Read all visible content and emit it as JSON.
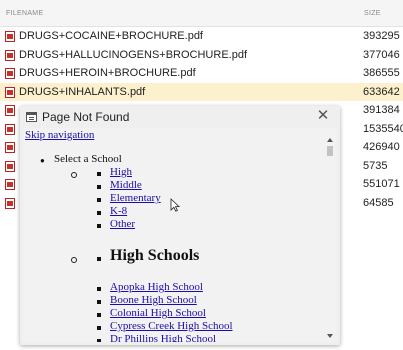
{
  "file_list": {
    "header_name": "FILENAME",
    "header_size": "SIZE",
    "rows": [
      {
        "name": "DRUGS+COCAINE+BROCHURE.pdf",
        "size": "393295"
      },
      {
        "name": "DRUGS+HALLUCINOGENS+BROCHURE.pdf",
        "size": "377046"
      },
      {
        "name": "DRUGS+HEROIN+BROCHURE.pdf",
        "size": "386555"
      },
      {
        "name": "DRUGS+INHALANTS.pdf",
        "size": "633642",
        "selected": true
      },
      {
        "name": "",
        "size": "391384"
      },
      {
        "name": "",
        "size": "1535540"
      },
      {
        "name": "",
        "size": "426940"
      },
      {
        "name": "",
        "size": "5735"
      },
      {
        "name": "",
        "size": "551071"
      },
      {
        "name": "",
        "size": "64585"
      }
    ]
  },
  "popup": {
    "title": "Page Not Found",
    "close_glyph": "✕",
    "skip_nav": "Skip navigation",
    "select_school": "Select a School",
    "school_levels": [
      "High",
      "Middle",
      "Elementary",
      "K-8",
      "Other"
    ],
    "high_schools_heading": "High Schools",
    "high_schools": [
      "Apopka High School",
      "Boone High School",
      "Colonial High School",
      "Cypress Creek High School",
      "Dr Phillips High School"
    ]
  }
}
